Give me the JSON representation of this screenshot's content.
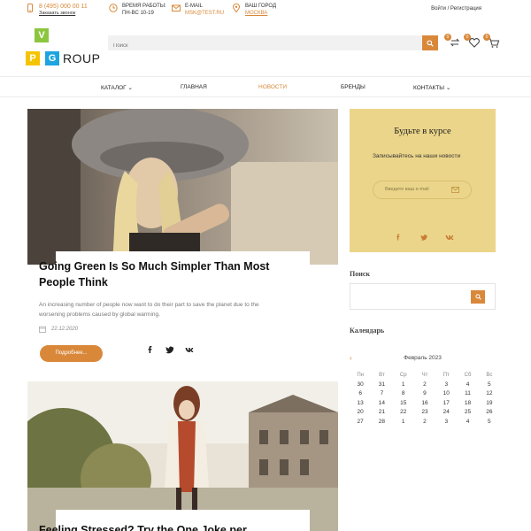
{
  "topbar": {
    "phone": "8 (495) 000 00 11",
    "callback": "Заказать звонок",
    "hours_label": "Время работы:",
    "hours_value": "ПН-ВС 10-19",
    "email_label": "E-mail",
    "email_value": "MSK@TEST.RU",
    "city_label": "Ваш город",
    "city_value": "Москва",
    "login": "Войти / Регистрация"
  },
  "header": {
    "logo_letters": [
      "V",
      "P",
      "G"
    ],
    "logo_word": "ROUP",
    "search_placeholder": "Поиск",
    "compare_count": "0",
    "favorites_count": "0",
    "cart_count": "0"
  },
  "nav": {
    "items": [
      {
        "label": "Каталог"
      },
      {
        "label": "Главная"
      },
      {
        "label": "Новости"
      },
      {
        "label": "Бренды"
      },
      {
        "label": "Контакты"
      }
    ]
  },
  "posts": [
    {
      "title": "Going Green Is So Much Simpler Than Most People Think",
      "excerpt": "An increasing number of people now want to do their part to save the planet due to the worsening problems caused by global warming.",
      "date": "22.12.2020",
      "button": "Подробнее..."
    },
    {
      "title": "Feeling Stressed? Try the One Joke per"
    }
  ],
  "sidebar": {
    "subscribe_title": "Будьте в курсе",
    "subscribe_text": "Записывайтесь на наши новости",
    "subscribe_placeholder": "Введите ваш e-mail",
    "search_heading": "Поиск",
    "calendar_heading": "Календарь"
  },
  "calendar": {
    "prev": "‹",
    "month": "Февраль 2023",
    "weekdays": [
      "Пн",
      "Вт",
      "Ср",
      "Чт",
      "Пт",
      "Сб",
      "Вс"
    ],
    "weeks": [
      [
        "30",
        "31",
        "1",
        "2",
        "3",
        "4",
        "5"
      ],
      [
        "6",
        "7",
        "8",
        "9",
        "10",
        "11",
        "12"
      ],
      [
        "13",
        "14",
        "15",
        "16",
        "17",
        "18",
        "19"
      ],
      [
        "20",
        "21",
        "22",
        "23",
        "24",
        "25",
        "26"
      ],
      [
        "27",
        "28",
        "1",
        "2",
        "3",
        "4",
        "5"
      ]
    ]
  },
  "colors": {
    "accent": "#d9883a",
    "subscribe_bg": "#ebd58a",
    "logo_green": "#8cc63f",
    "logo_yellow": "#f5c400",
    "logo_blue": "#1ea5e0"
  },
  "icons": {
    "phone": "phone-icon",
    "clock": "clock-icon",
    "mail": "mail-icon",
    "location": "location-pin-icon",
    "search": "search-icon",
    "compare": "compare-icon",
    "favorites": "heart-icon",
    "cart": "cart-icon",
    "calendar": "calendar-icon",
    "facebook": "facebook-icon",
    "twitter": "twitter-icon",
    "vk": "vk-icon"
  }
}
